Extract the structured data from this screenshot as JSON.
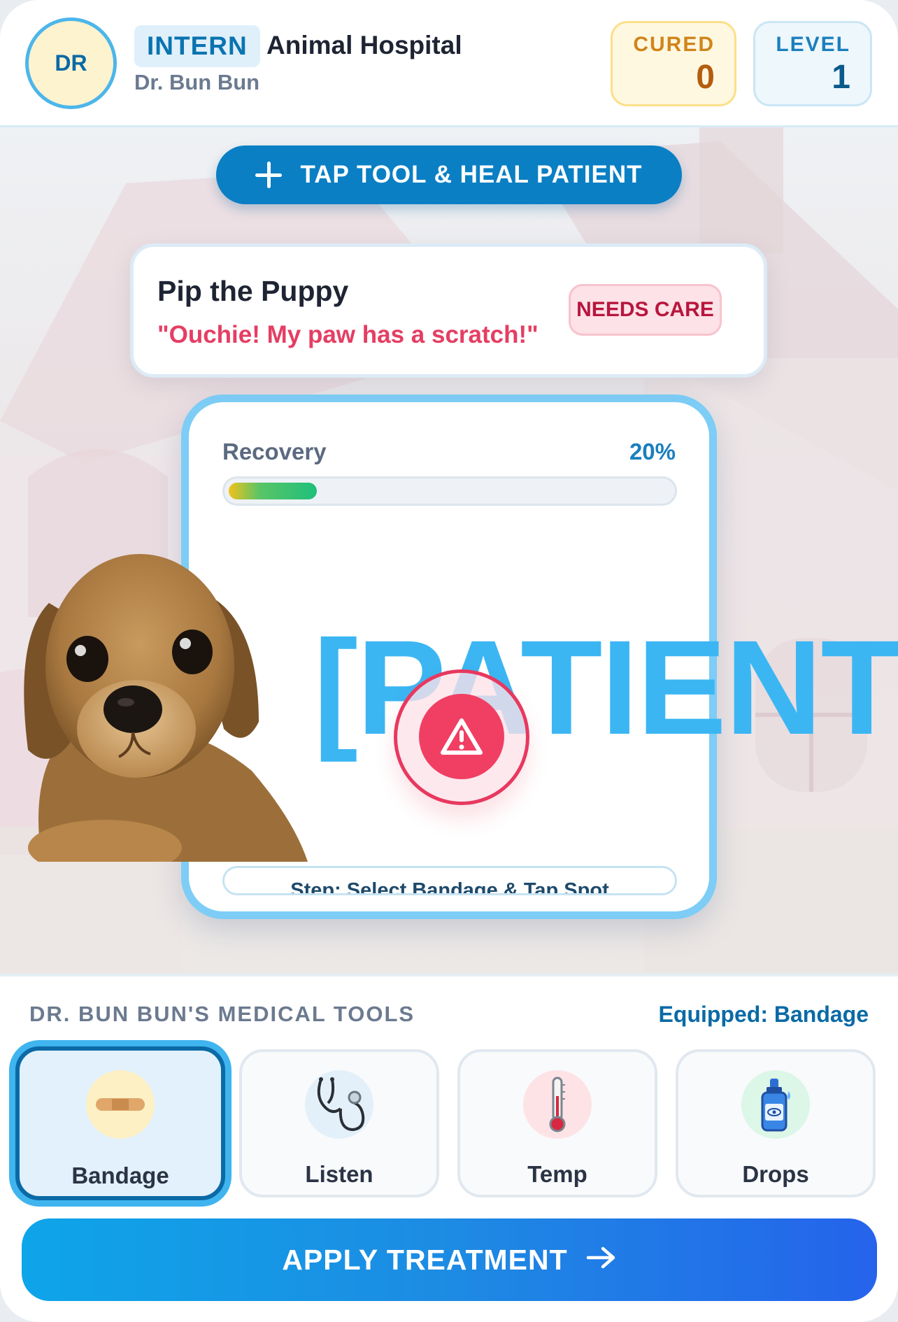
{
  "header": {
    "avatar_initials": "DR",
    "rank": "INTERN",
    "hospital": "Animal Hospital",
    "doctor": "Dr. Bun Bun",
    "stats": {
      "cured_label": "CURED",
      "cured_value": "0",
      "level_label": "LEVEL",
      "level_value": "1"
    }
  },
  "scene": {
    "instruction": "TAP TOOL & HEAL PATIENT",
    "instruction_icon": "plus-icon",
    "patient": {
      "name": "Pip the Puppy",
      "quote": "\"Ouchie! My paw has a scratch!\"",
      "status": "NEEDS CARE"
    },
    "exam": {
      "recovery_label": "Recovery",
      "recovery_percent_text": "20%",
      "recovery_fraction": 0.2,
      "step_text": "Step: Select Bandage & Tap Spot",
      "placeholder": "[PATIENT]",
      "alert_icon": "warning-icon"
    }
  },
  "tools": {
    "title": "DR. BUN BUN'S MEDICAL TOOLS",
    "equipped": "Equipped: Bandage",
    "items": [
      {
        "label": "Bandage",
        "icon": "bandage-icon",
        "selected": true
      },
      {
        "label": "Listen",
        "icon": "stethoscope-icon",
        "selected": false
      },
      {
        "label": "Temp",
        "icon": "thermometer-icon",
        "selected": false
      },
      {
        "label": "Drops",
        "icon": "eye-drops-icon",
        "selected": false
      }
    ],
    "apply_label": "APPLY TREATMENT",
    "apply_icon": "arrow-right-icon"
  },
  "colors": {
    "accent": "#0a7fc4",
    "alert": "#f03f63",
    "card_border": "#7dcdf6"
  }
}
